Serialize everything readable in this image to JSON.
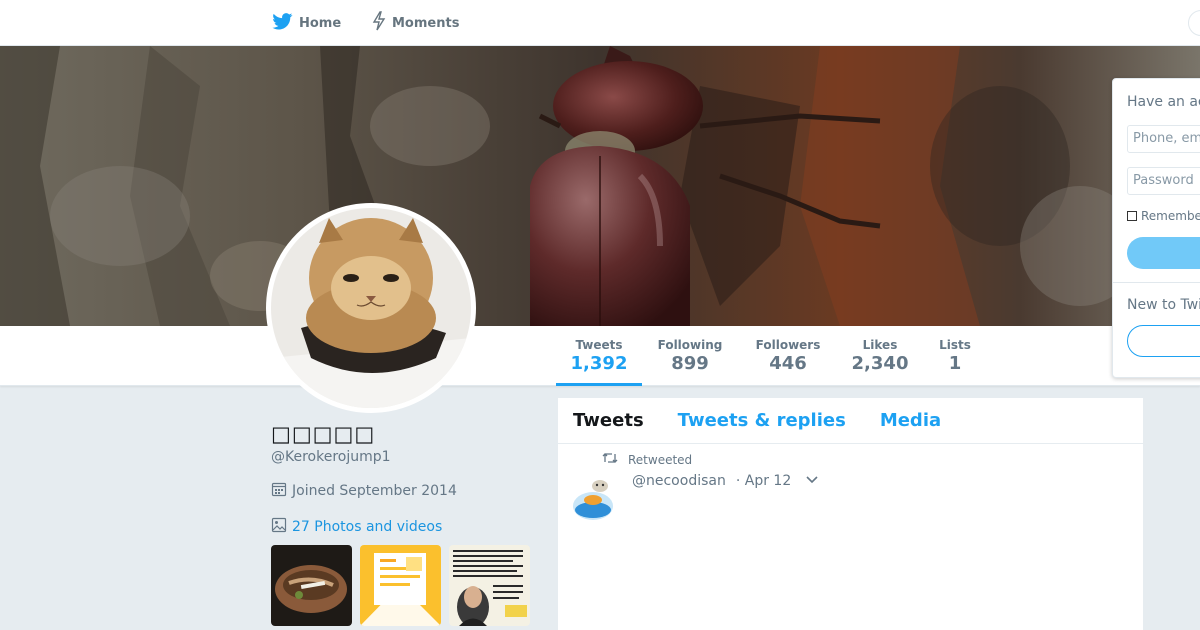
{
  "nav": {
    "home_label": "Home",
    "moments_label": "Moments"
  },
  "stats": [
    {
      "label": "Tweets",
      "value": "1,392"
    },
    {
      "label": "Following",
      "value": "899"
    },
    {
      "label": "Followers",
      "value": "446"
    },
    {
      "label": "Likes",
      "value": "2,340"
    },
    {
      "label": "Lists",
      "value": "1"
    }
  ],
  "profile": {
    "name": "□□□□□",
    "handle": "@Kerokerojump1",
    "joined": "Joined September 2014",
    "photos_link": "27 Photos and videos"
  },
  "timeline": {
    "tabs": [
      {
        "label": "Tweets"
      },
      {
        "label": "Tweets & replies"
      },
      {
        "label": "Media"
      }
    ],
    "tweet": {
      "retweeted_label": "Retweeted",
      "handle": "@necoodisan",
      "date": "· Apr 12"
    }
  },
  "login": {
    "title": "Have an ac",
    "phone_placeholder": "Phone, em",
    "password_placeholder": "Password",
    "remember": "Remembe",
    "new_to": "New to Twi"
  },
  "colors": {
    "accent": "#1da1f2",
    "background": "#e6ecf0"
  },
  "icons": {
    "nav_home": "twitter-bird-icon",
    "nav_moments": "lightning-icon",
    "joined": "calendar-icon",
    "photos": "image-icon",
    "retweet": "retweet-icon",
    "caret": "chevron-down-icon"
  }
}
